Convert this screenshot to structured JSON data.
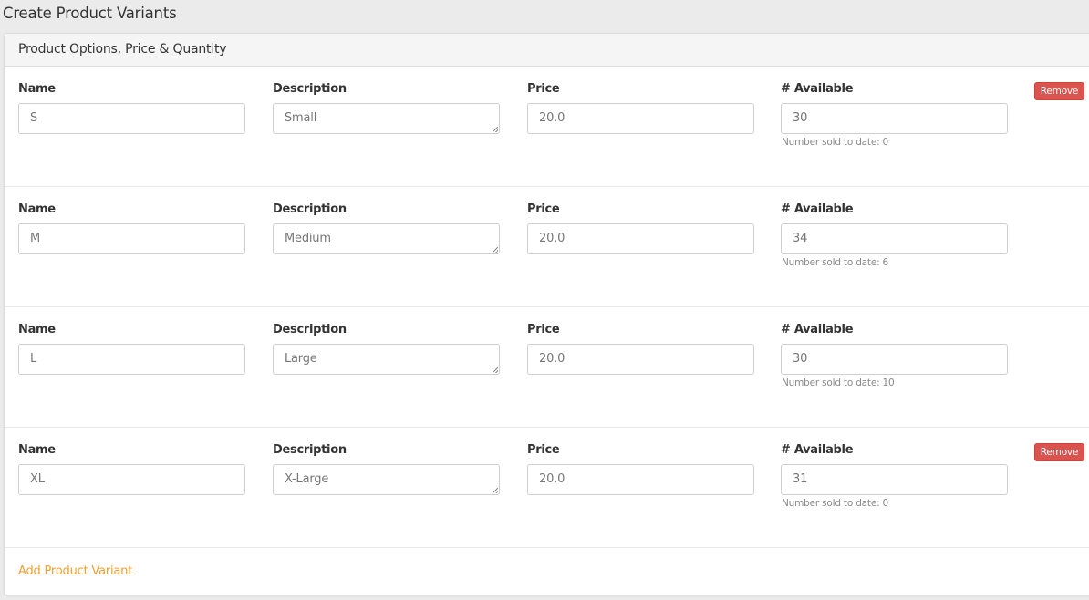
{
  "page": {
    "title": "Create Product Variants"
  },
  "panel": {
    "heading": "Product Options, Price & Quantity",
    "add_variant_label": "Add Product Variant",
    "accent_color": "#f0a030",
    "remove_color": "#d9534f"
  },
  "labels": {
    "name": "Name",
    "description": "Description",
    "price": "Price",
    "available": "# Available",
    "remove": "Remove"
  },
  "variants": [
    {
      "name": "S",
      "description": "Small",
      "price": "20.0",
      "available": "30",
      "sold_note": "Number sold to date: 0",
      "removable": true
    },
    {
      "name": "M",
      "description": "Medium",
      "price": "20.0",
      "available": "34",
      "sold_note": "Number sold to date: 6",
      "removable": false
    },
    {
      "name": "L",
      "description": "Large",
      "price": "20.0",
      "available": "30",
      "sold_note": "Number sold to date: 10",
      "removable": false
    },
    {
      "name": "XL",
      "description": "X-Large",
      "price": "20.0",
      "available": "31",
      "sold_note": "Number sold to date: 0",
      "removable": true
    }
  ]
}
